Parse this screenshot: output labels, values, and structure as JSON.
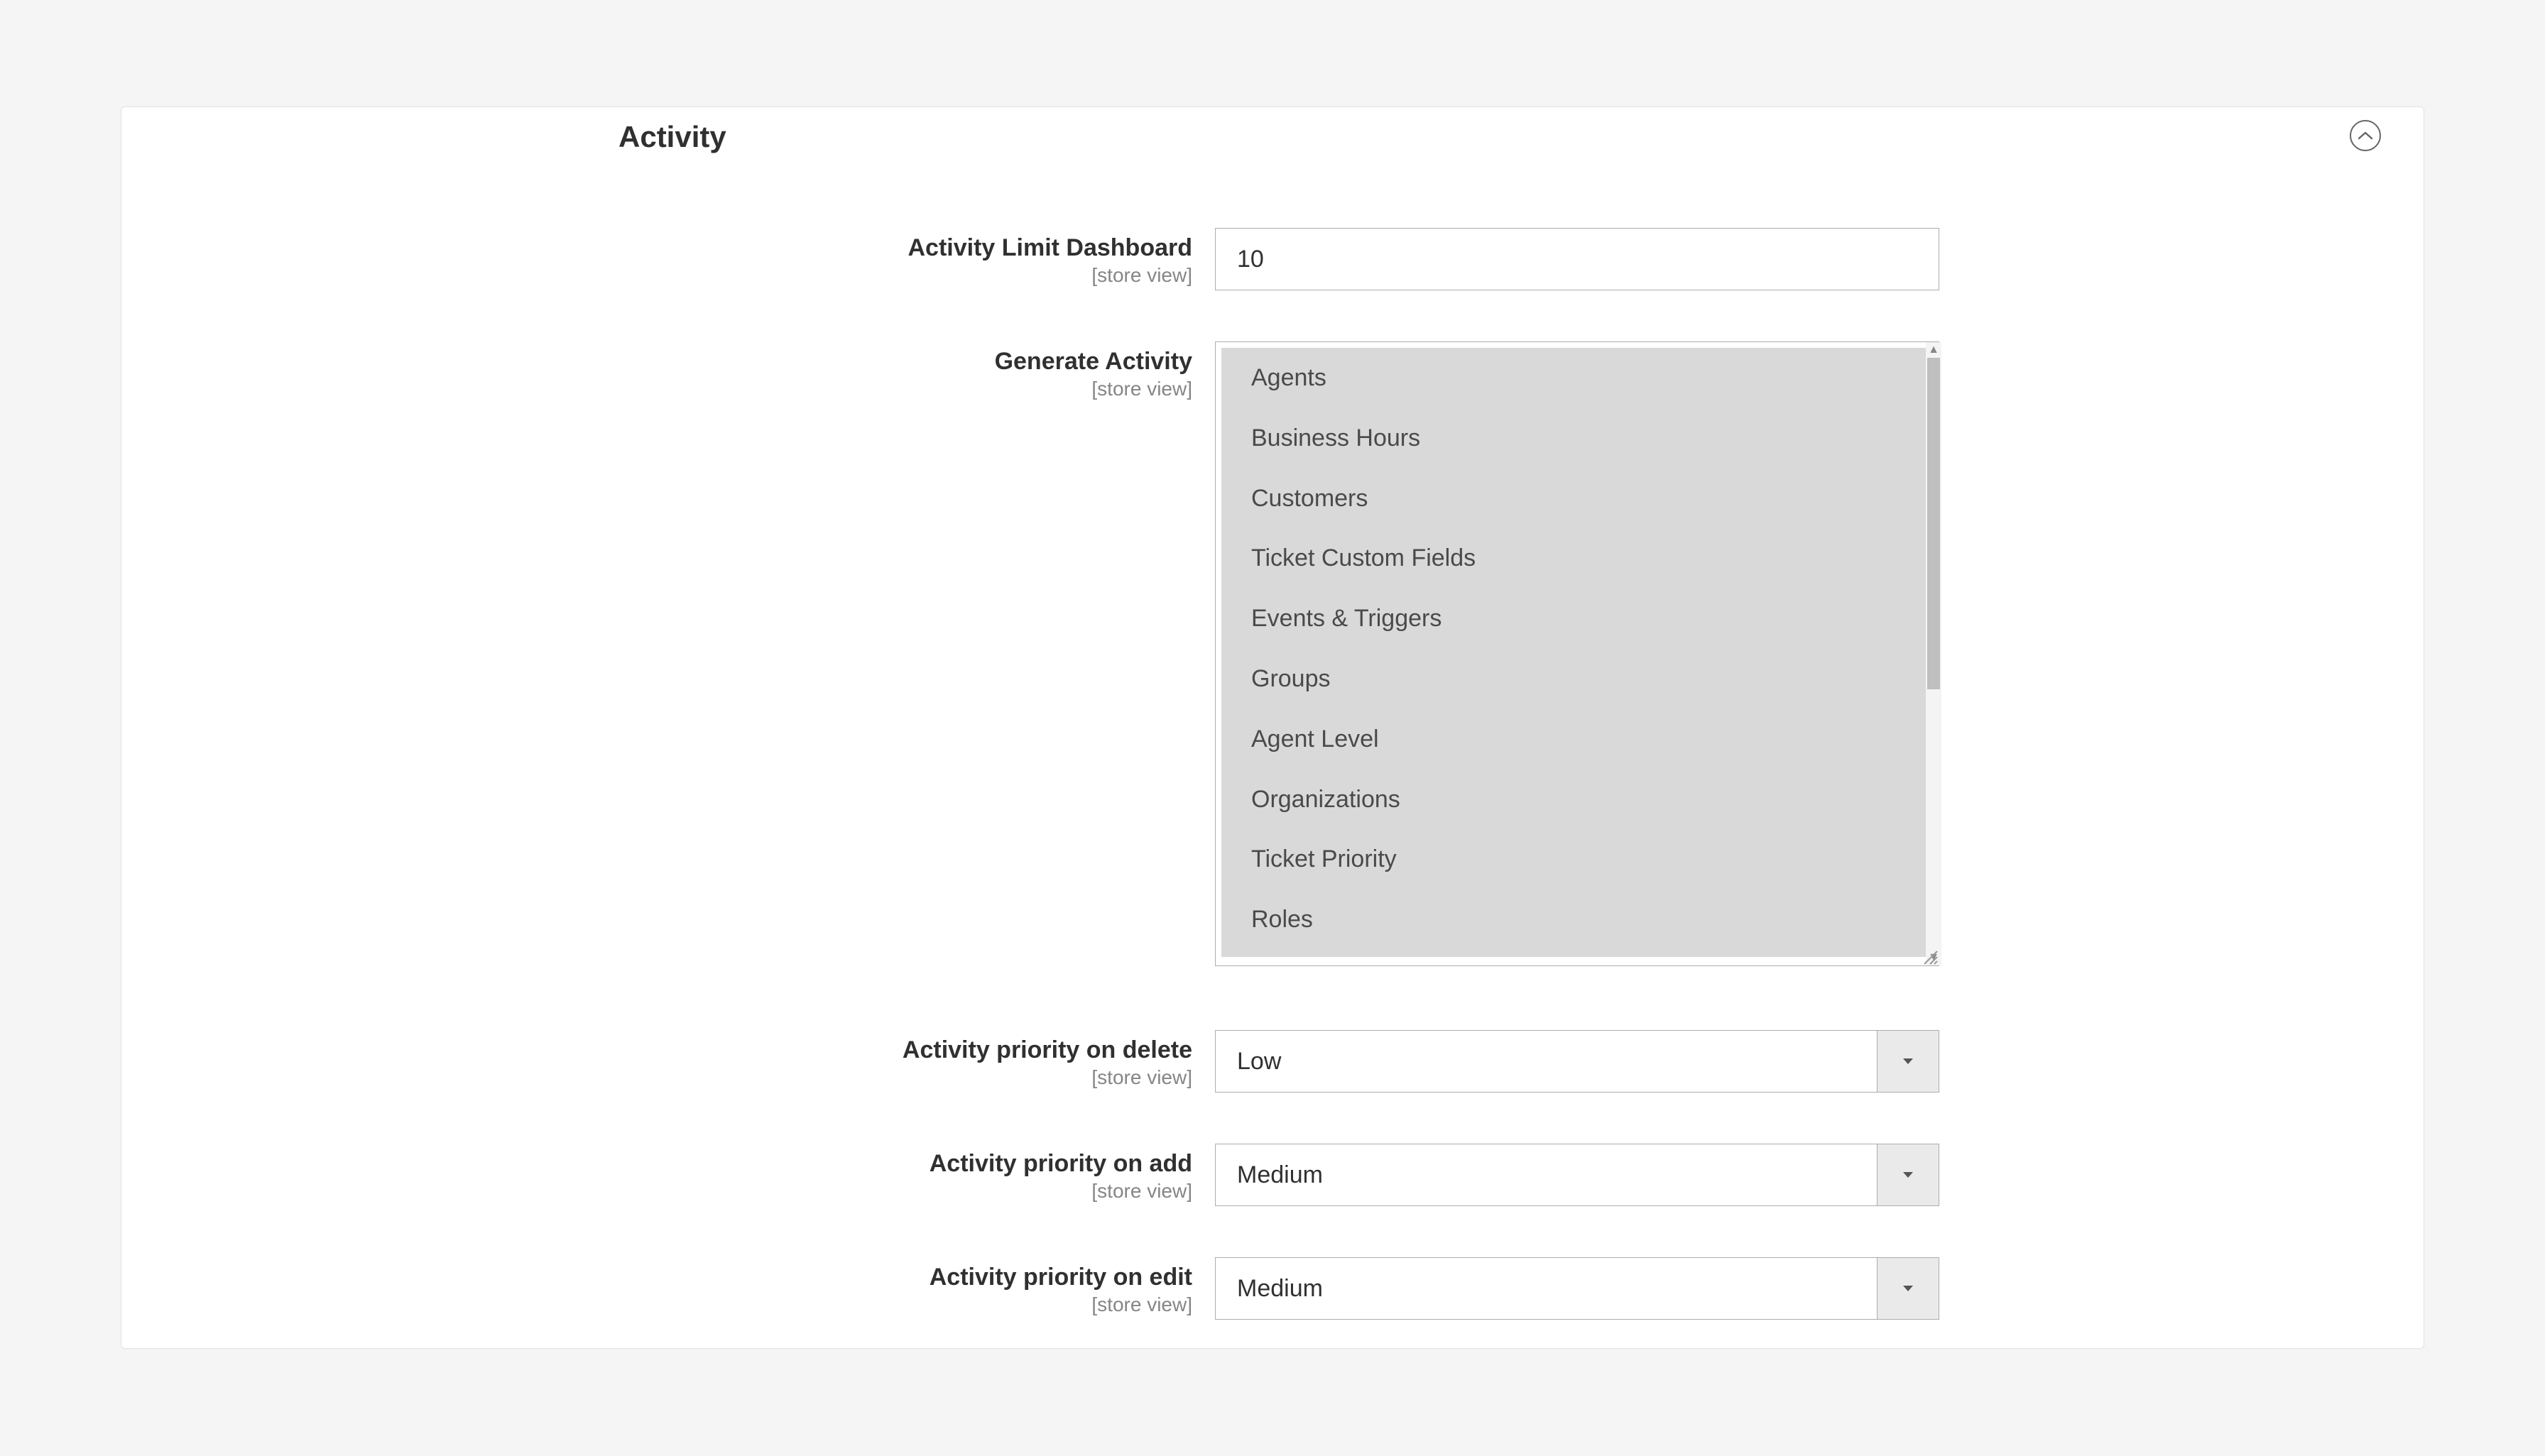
{
  "section": {
    "title": "Activity"
  },
  "fields": {
    "limit": {
      "label": "Activity Limit Dashboard",
      "scope": "[store view]",
      "value": "10"
    },
    "generate": {
      "label": "Generate Activity",
      "scope": "[store view]",
      "options": [
        "Agents",
        "Business Hours",
        "Customers",
        "Ticket Custom Fields",
        "Events & Triggers",
        "Groups",
        "Agent Level",
        "Organizations",
        "Ticket Priority",
        "Roles"
      ]
    },
    "priority_delete": {
      "label": "Activity priority on delete",
      "scope": "[store view]",
      "value": "Low"
    },
    "priority_add": {
      "label": "Activity priority on add",
      "scope": "[store view]",
      "value": "Medium"
    },
    "priority_edit": {
      "label": "Activity priority on edit",
      "scope": "[store view]",
      "value": "Medium"
    }
  }
}
